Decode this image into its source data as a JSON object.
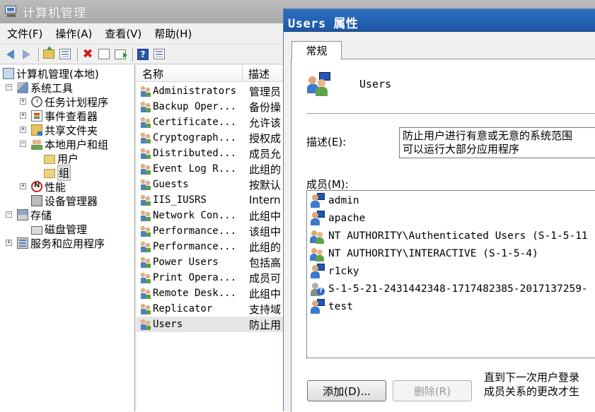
{
  "mmc": {
    "title": "计算机管理",
    "menu": [
      "文件(F)",
      "操作(A)",
      "查看(V)",
      "帮助(H)"
    ],
    "toolbar": [
      "back-icon",
      "forward-icon",
      "up-folder-icon",
      "show-hide-tree-icon",
      "delete-icon",
      "properties-icon",
      "export-list-icon",
      "help-icon",
      "view-icon"
    ],
    "tree": [
      {
        "label": "计算机管理(本地)",
        "icon": "computer-icon",
        "expander": ""
      },
      {
        "label": "系统工具",
        "icon": "tools-icon",
        "expander": "−"
      },
      {
        "label": "任务计划程序",
        "icon": "clock-icon",
        "expander": "+"
      },
      {
        "label": "事件查看器",
        "icon": "event-viewer-icon",
        "expander": "+"
      },
      {
        "label": "共享文件夹",
        "icon": "shared-folder-icon",
        "expander": "+"
      },
      {
        "label": "本地用户和组",
        "icon": "users-icon",
        "expander": "−"
      },
      {
        "label": "用户",
        "icon": "folder-icon",
        "expander": ""
      },
      {
        "label": "组",
        "icon": "folder-icon",
        "expander": ""
      },
      {
        "label": "性能",
        "icon": "performance-icon",
        "expander": "+"
      },
      {
        "label": "设备管理器",
        "icon": "device-manager-icon",
        "expander": ""
      },
      {
        "label": "存储",
        "icon": "storage-icon",
        "expander": "−"
      },
      {
        "label": "磁盘管理",
        "icon": "disk-icon",
        "expander": ""
      },
      {
        "label": "服务和应用程序",
        "icon": "services-icon",
        "expander": "+"
      }
    ],
    "list": {
      "columns": [
        "名称",
        "描述"
      ],
      "rows": [
        {
          "name": "Administrators",
          "desc": "管理员"
        },
        {
          "name": "Backup Oper...",
          "desc": "备份操"
        },
        {
          "name": "Certificate...",
          "desc": "允许该"
        },
        {
          "name": "Cryptograph...",
          "desc": "授权成"
        },
        {
          "name": "Distributed...",
          "desc": "成员允"
        },
        {
          "name": "Event Log R...",
          "desc": "此组的"
        },
        {
          "name": "Guests",
          "desc": "按默认"
        },
        {
          "name": "IIS_IUSRS",
          "desc": "Intern"
        },
        {
          "name": "Network Con...",
          "desc": "此组中"
        },
        {
          "name": "Performance...",
          "desc": "该组中"
        },
        {
          "name": "Performance...",
          "desc": "此组的"
        },
        {
          "name": "Power Users",
          "desc": "包括高"
        },
        {
          "name": "Print Opera...",
          "desc": "成员可"
        },
        {
          "name": "Remote Desk...",
          "desc": "此组中"
        },
        {
          "name": "Replicator",
          "desc": "支持域"
        },
        {
          "name": "Users",
          "desc": "防止用"
        }
      ]
    }
  },
  "dialog": {
    "title": "Users 属性",
    "tab": "常规",
    "group_name": "Users",
    "desc_label": "描述(E):",
    "description": "防止用户进行有意或无意的系统范围\n可以运行大部分应用程序",
    "members_label": "成员(M):",
    "members": [
      {
        "name": "admin",
        "icon": "user-icon"
      },
      {
        "name": "apache",
        "icon": "user-icon"
      },
      {
        "name": "NT AUTHORITY\\Authenticated Users (S-1-5-11",
        "icon": "group-icon"
      },
      {
        "name": "NT AUTHORITY\\INTERACTIVE (S-1-5-4)",
        "icon": "group-icon"
      },
      {
        "name": "r1cky",
        "icon": "user-icon"
      },
      {
        "name": "S-1-5-21-2431442348-1717482385-2017137259-",
        "icon": "unknown-user-icon"
      },
      {
        "name": "test",
        "icon": "user-icon"
      }
    ],
    "add_button": "添加(D)...",
    "remove_button": "删除(R)",
    "note": "直到下一次用户登录\n成员关系的更改才生"
  }
}
